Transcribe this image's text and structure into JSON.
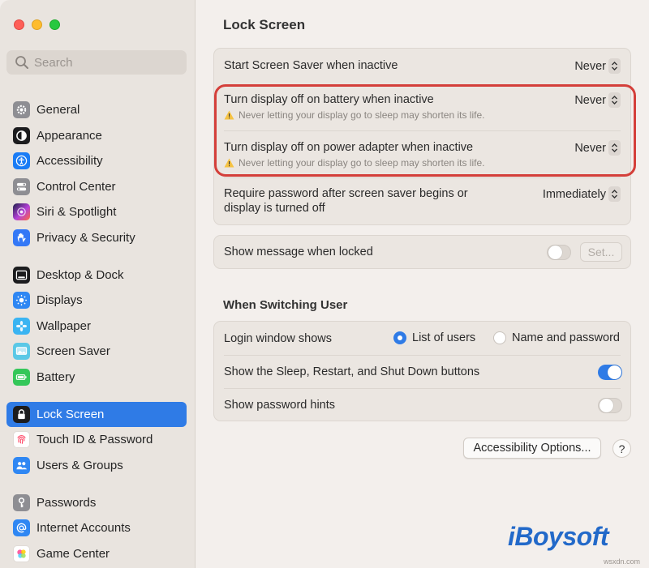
{
  "window": {
    "traffic_lights": {
      "close": "#fe5f57",
      "minimize": "#febc2e",
      "zoom": "#28c840"
    }
  },
  "sidebar": {
    "search_placeholder": "Search",
    "items": [
      {
        "label": "General",
        "icon": "gear-icon",
        "color": "#8e8e93"
      },
      {
        "label": "Appearance",
        "icon": "appearance-icon",
        "color": "#1c1c1e"
      },
      {
        "label": "Accessibility",
        "icon": "accessibility-icon",
        "color": "#1a7cf5"
      },
      {
        "label": "Control Center",
        "icon": "control-center-icon",
        "color": "#8e8e93"
      },
      {
        "label": "Siri & Spotlight",
        "icon": "siri-icon",
        "color": "#b541d8"
      },
      {
        "label": "Privacy & Security",
        "icon": "hand-icon",
        "color": "#3478f6"
      },
      {
        "label": "Desktop & Dock",
        "icon": "dock-icon",
        "color": "#1c1c1e"
      },
      {
        "label": "Displays",
        "icon": "displays-icon",
        "color": "#2f87f3"
      },
      {
        "label": "Wallpaper",
        "icon": "wallpaper-icon",
        "color": "#3ab4f2"
      },
      {
        "label": "Screen Saver",
        "icon": "screen-saver-icon",
        "color": "#5ac8e6"
      },
      {
        "label": "Battery",
        "icon": "battery-icon",
        "color": "#34c759"
      },
      {
        "label": "Lock Screen",
        "icon": "lock-icon",
        "color": "#1c1c1e",
        "selected": true
      },
      {
        "label": "Touch ID & Password",
        "icon": "fingerprint-icon",
        "color": "#ffffff"
      },
      {
        "label": "Users & Groups",
        "icon": "users-icon",
        "color": "#2f87f3"
      },
      {
        "label": "Passwords",
        "icon": "key-icon",
        "color": "#8e8e93"
      },
      {
        "label": "Internet Accounts",
        "icon": "at-icon",
        "color": "#2f87f3"
      },
      {
        "label": "Game Center",
        "icon": "game-center-icon",
        "color": "#ffffff"
      }
    ]
  },
  "main": {
    "title": "Lock Screen",
    "screen_saver_row": {
      "label": "Start Screen Saver when inactive",
      "value": "Never"
    },
    "battery_row": {
      "label": "Turn display off on battery when inactive",
      "warning": "Never letting your display go to sleep may shorten its life.",
      "value": "Never"
    },
    "adapter_row": {
      "label": "Turn display off on power adapter when inactive",
      "warning": "Never letting your display go to sleep may shorten its life.",
      "value": "Never"
    },
    "password_row": {
      "label_line1": "Require password after screen saver begins or",
      "label_line2": "display is turned off",
      "value": "Immediately"
    },
    "message_row": {
      "label": "Show message when locked",
      "toggle_on": false,
      "set_label": "Set..."
    },
    "switching_title": "When Switching User",
    "login_row": {
      "label": "Login window shows",
      "option1": "List of users",
      "option2": "Name and password",
      "selected": "List of users"
    },
    "sleep_row": {
      "label": "Show the Sleep, Restart, and Shut Down buttons",
      "toggle_on": true
    },
    "hints_row": {
      "label": "Show password hints",
      "toggle_on": false
    },
    "accessibility_button": "Accessibility Options...",
    "help_button": "?"
  },
  "overlay": {
    "watermark": "iBoysoft",
    "site": "wsxdn.com",
    "highlight_color": "#d43f3a"
  }
}
